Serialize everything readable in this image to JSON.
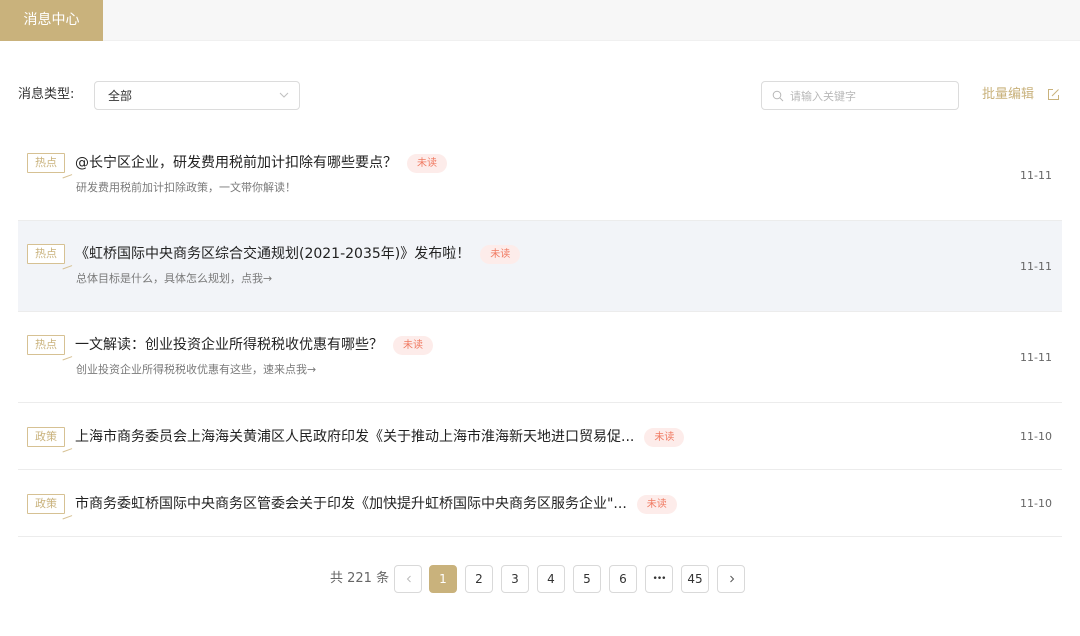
{
  "tabs": {
    "active_label": "消息中心"
  },
  "filter": {
    "label": "消息类型:",
    "selected": "全部"
  },
  "search": {
    "placeholder": "请输入关键字"
  },
  "toolbar": {
    "batch_edit_label": "批量编辑"
  },
  "messages": [
    {
      "tag": "热点",
      "title": "@长宁区企业，研发费用税前加计扣除有哪些要点？",
      "badge": "未读",
      "summary": "研发费用税前加计扣除政策，一文带你解读！",
      "date": "11-11"
    },
    {
      "tag": "热点",
      "title": "《虹桥国际中央商务区综合交通规划(2021-2035年)》发布啦！",
      "badge": "未读",
      "summary": "总体目标是什么，具体怎么规划，点我→",
      "date": "11-11"
    },
    {
      "tag": "热点",
      "title": "一文解读：创业投资企业所得税税收优惠有哪些？",
      "badge": "未读",
      "summary": "创业投资企业所得税税收优惠有这些，速来点我→",
      "date": "11-11"
    },
    {
      "tag": "政策",
      "title": "上海市商务委员会上海海关黄浦区人民政府印发《关于推动上海市淮海新天地进口贸易促...",
      "badge": "未读",
      "summary": "",
      "date": "11-10"
    },
    {
      "tag": "政策",
      "title": "市商务委虹桥国际中央商务区管委会关于印发《加快提升虹桥国际中央商务区服务企业\"...",
      "badge": "未读",
      "summary": "",
      "date": "11-10"
    }
  ],
  "pagination": {
    "total_label": "共 221 条",
    "pages": [
      "1",
      "2",
      "3",
      "4",
      "5",
      "6"
    ],
    "ellipsis": "•••",
    "last_page": "45",
    "current_page": 1
  },
  "colors": {
    "accent": "#c9b27c",
    "unread_bg": "#fdecea",
    "unread_text": "#f07a62",
    "hover_row": "#f2f4f8"
  }
}
